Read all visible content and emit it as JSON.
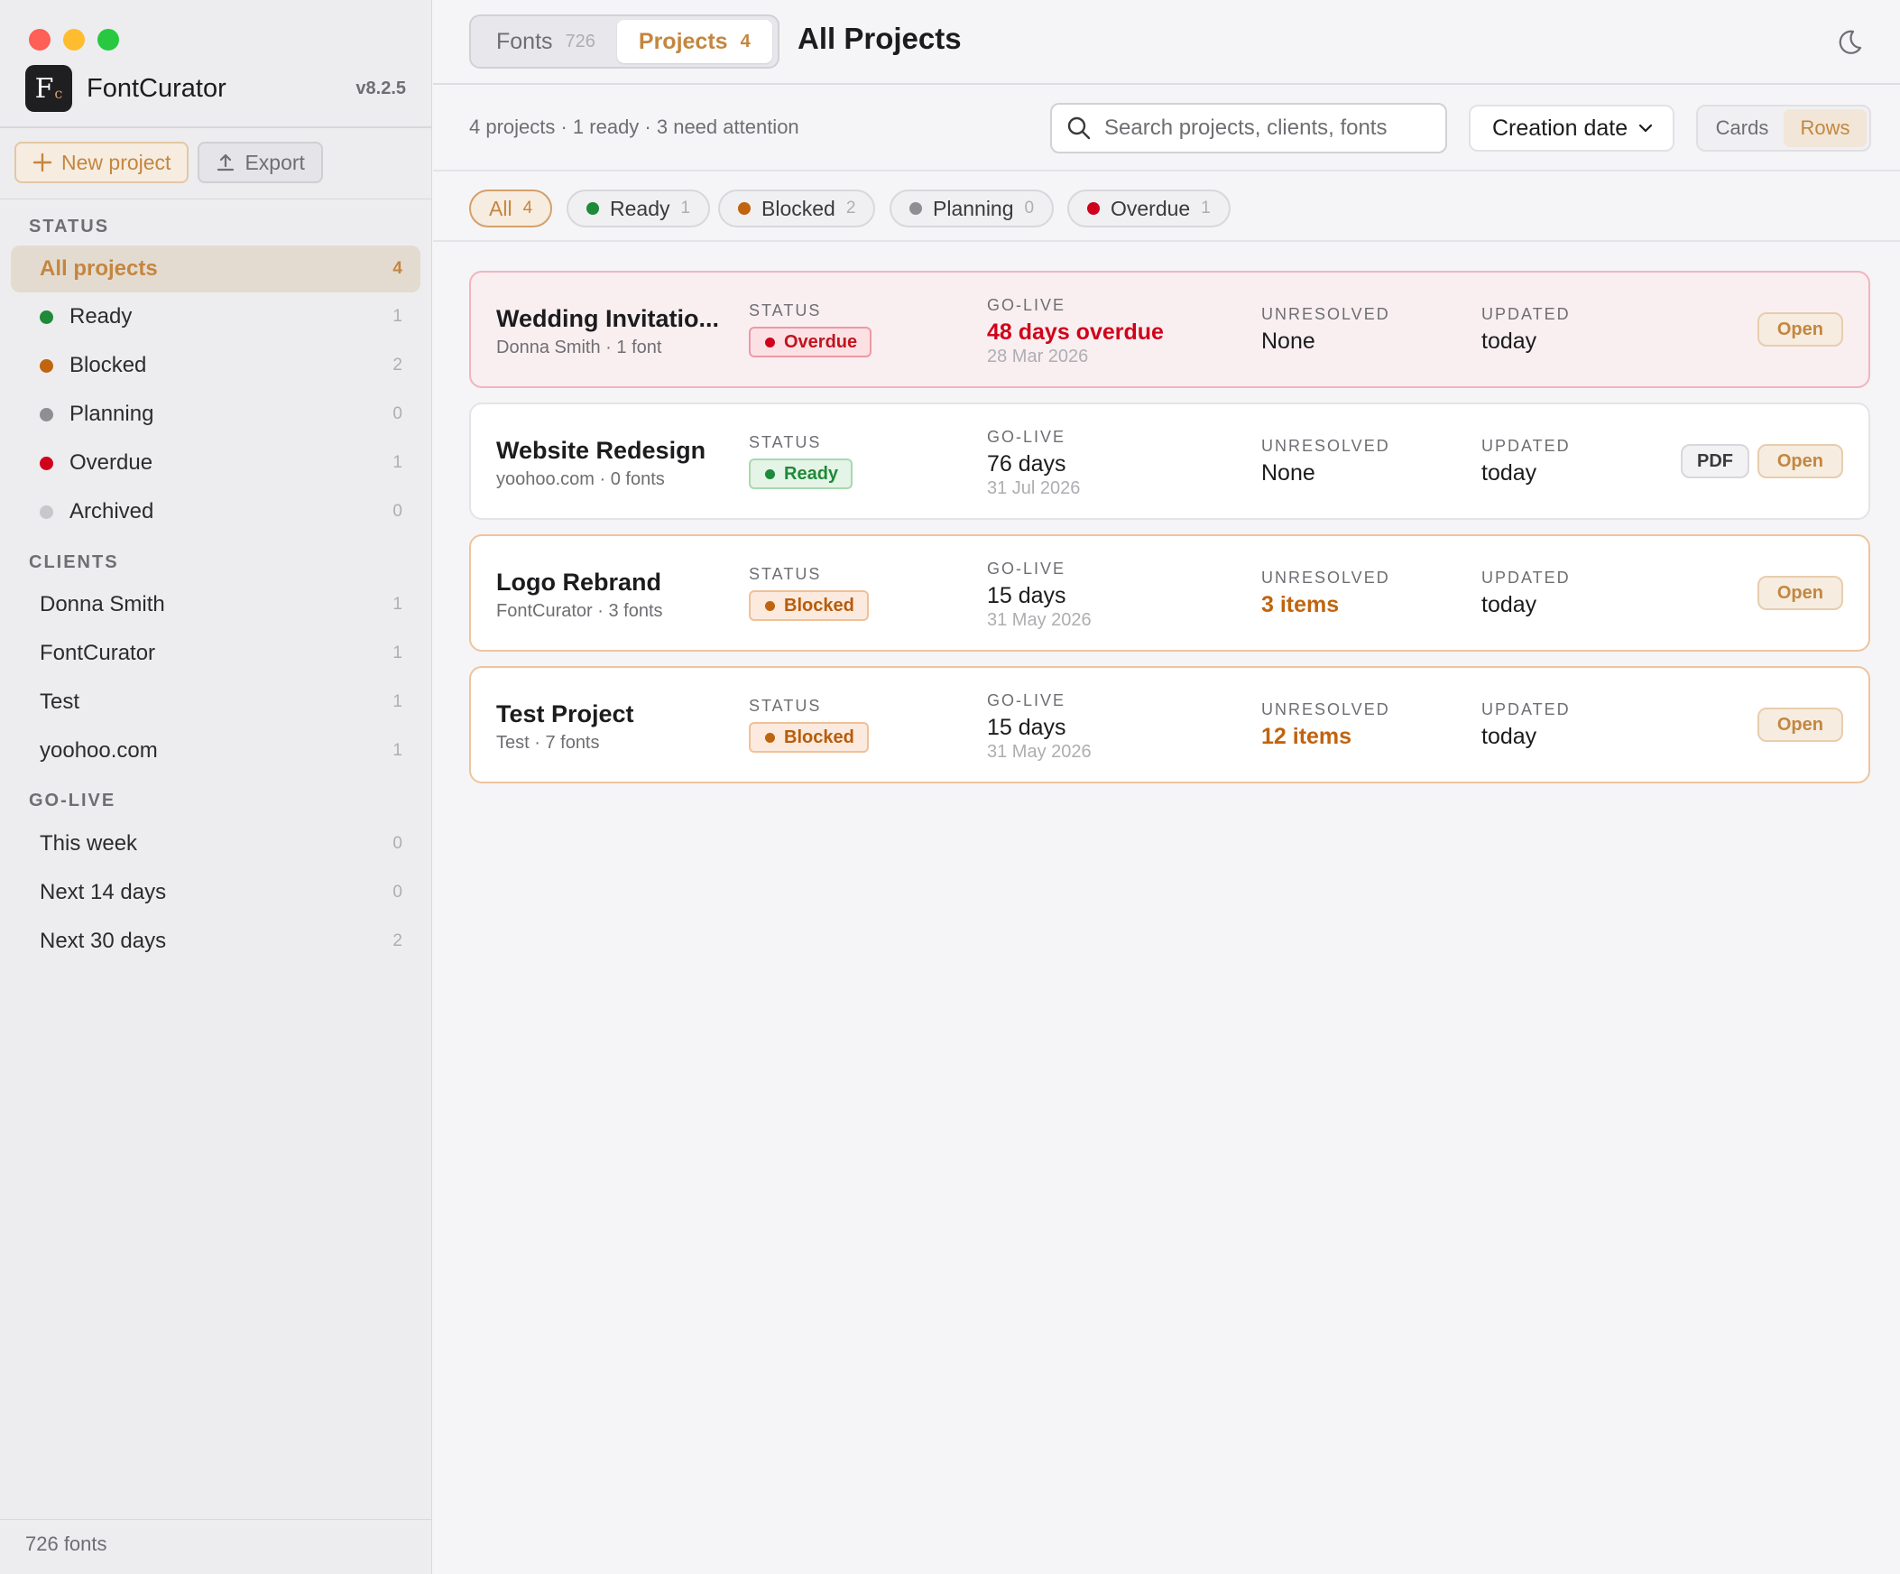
{
  "app": {
    "name": "FontCurator",
    "version": "v8.2.5",
    "logo_text": "F",
    "logo_sub": "c"
  },
  "sidebar": {
    "new_project": "New project",
    "export": "Export",
    "status_label": "STATUS",
    "status_items": [
      {
        "label": "All projects",
        "count": "4"
      },
      {
        "label": "Ready",
        "count": "1",
        "color": "#1f8a39"
      },
      {
        "label": "Blocked",
        "count": "2",
        "color": "#c0640f"
      },
      {
        "label": "Planning",
        "count": "0",
        "color": "#8e8e93"
      },
      {
        "label": "Overdue",
        "count": "1",
        "color": "#d0021b"
      },
      {
        "label": "Archived",
        "count": "0",
        "color": "#c7c7cc"
      }
    ],
    "clients_label": "CLIENTS",
    "clients": [
      {
        "label": "Donna Smith",
        "count": "1"
      },
      {
        "label": "FontCurator",
        "count": "1"
      },
      {
        "label": "Test",
        "count": "1"
      },
      {
        "label": "yoohoo.com",
        "count": "1"
      }
    ],
    "golive_label": "GO-LIVE",
    "golive": [
      {
        "label": "This week",
        "count": "0"
      },
      {
        "label": "Next 14 days",
        "count": "0"
      },
      {
        "label": "Next 30 days",
        "count": "2"
      }
    ],
    "footer": "726 fonts"
  },
  "header": {
    "tabs": [
      {
        "label": "Fonts",
        "count": "726"
      },
      {
        "label": "Projects",
        "count": "4"
      }
    ],
    "title": "All Projects"
  },
  "toolbar": {
    "summary": "4 projects · 1 ready · 3 need attention",
    "search_placeholder": "Search projects, clients, fonts",
    "sort": "Creation date",
    "views": [
      "Cards",
      "Rows"
    ]
  },
  "filters": [
    {
      "label": "All",
      "count": "4"
    },
    {
      "label": "Ready",
      "count": "1",
      "color": "#1f8a39"
    },
    {
      "label": "Blocked",
      "count": "2",
      "color": "#c0640f"
    },
    {
      "label": "Planning",
      "count": "0",
      "color": "#8e8e93"
    },
    {
      "label": "Overdue",
      "count": "1",
      "color": "#d0021b"
    }
  ],
  "columns": {
    "status": "STATUS",
    "golive": "GO-LIVE",
    "unresolved": "UNRESOLVED",
    "updated": "UPDATED"
  },
  "projects": [
    {
      "name": "Wedding Invitatio...",
      "sub": "Donna Smith · 1 font",
      "status": "Overdue",
      "golive": "48 days overdue",
      "date": "28 Mar 2026",
      "unresolved": "None",
      "updated": "today",
      "open": "Open"
    },
    {
      "name": "Website Redesign",
      "sub": "yoohoo.com · 0 fonts",
      "status": "Ready",
      "golive": "76 days",
      "date": "31 Jul 2026",
      "unresolved": "None",
      "updated": "today",
      "pdf": "PDF",
      "open": "Open"
    },
    {
      "name": "Logo Rebrand",
      "sub": "FontCurator · 3 fonts",
      "status": "Blocked",
      "golive": "15 days",
      "date": "31 May 2026",
      "unresolved": "3 items",
      "updated": "today",
      "open": "Open"
    },
    {
      "name": "Test Project",
      "sub": "Test · 7 fonts",
      "status": "Blocked",
      "golive": "15 days",
      "date": "31 May 2026",
      "unresolved": "12 items",
      "updated": "today",
      "open": "Open"
    }
  ]
}
